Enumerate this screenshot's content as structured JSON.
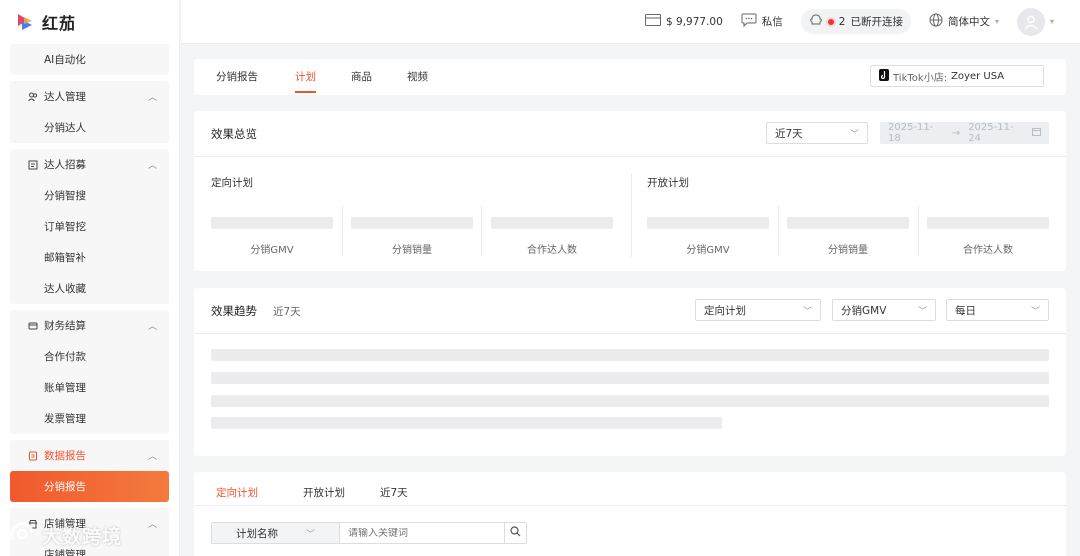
{
  "app": {
    "name": "红茄"
  },
  "sidebar": {
    "top_item": "AI自动化",
    "groups": [
      {
        "title": "达人管理",
        "icon": "users-icon",
        "items": [
          "分销达人"
        ]
      },
      {
        "title": "达人招募",
        "icon": "recruit-icon",
        "items": [
          "分销智搜",
          "订单智挖",
          "邮箱智补",
          "达人收藏"
        ]
      },
      {
        "title": "财务结算",
        "icon": "finance-icon",
        "items": [
          "合作付款",
          "账单管理",
          "发票管理"
        ]
      },
      {
        "title": "数据报告",
        "icon": "report-icon",
        "items": [
          "分销报告"
        ],
        "active": true
      },
      {
        "title": "店铺管理",
        "icon": "shop-icon",
        "items": [
          "店铺管理"
        ]
      }
    ]
  },
  "topbar": {
    "balance": "$ 9,977.00",
    "messages": "私信",
    "connection_count": "2",
    "connection_status": "已断开连接",
    "language": "简体中文"
  },
  "tabs": [
    "分销报告",
    "计划",
    "商品",
    "视频"
  ],
  "active_tab": "计划",
  "shop": {
    "label": "TikTok小店:",
    "value": "Zoyer USA"
  },
  "overview": {
    "title": "效果总览",
    "range_select": "近7天",
    "date_start": "2025-11-18",
    "date_end": "2025-11-24",
    "sections": [
      {
        "title": "定向计划",
        "metrics": [
          "分销GMV",
          "分销销量",
          "合作达人数"
        ]
      },
      {
        "title": "开放计划",
        "metrics": [
          "分销GMV",
          "分销销量",
          "合作达人数"
        ]
      }
    ]
  },
  "trend": {
    "title": "效果趋势",
    "subtitle": "近7天",
    "plan_select": "定向计划",
    "metric_select": "分销GMV",
    "interval_select": "每日"
  },
  "table": {
    "subtabs": [
      "定向计划",
      "开放计划",
      "近7天"
    ],
    "field_type": "计划名称",
    "search_placeholder": "请输入关键词"
  },
  "watermark": "大数跨境",
  "colors": {
    "accent": "#f0542d",
    "skeleton": "#ececee"
  }
}
